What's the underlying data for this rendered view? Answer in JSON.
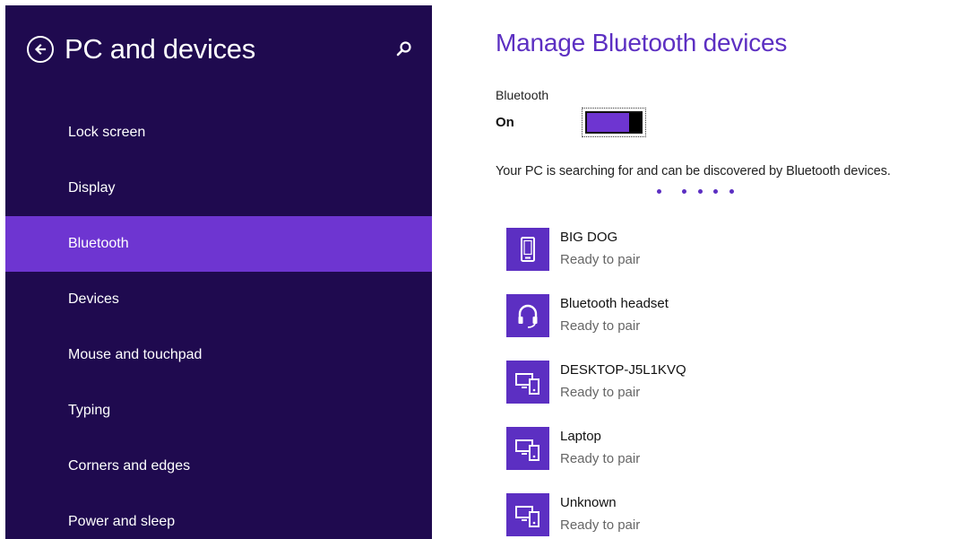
{
  "sidebar": {
    "title": "PC and devices",
    "items": [
      {
        "label": "Lock screen",
        "icon": ""
      },
      {
        "label": "Display"
      },
      {
        "label": "Bluetooth",
        "active": true
      },
      {
        "label": "Devices"
      },
      {
        "label": "Mouse and touchpad"
      },
      {
        "label": "Typing"
      },
      {
        "label": "Corners and edges"
      },
      {
        "label": "Power and sleep"
      }
    ],
    "back_icon": "back-arrow-icon",
    "search_icon": "search-icon"
  },
  "main": {
    "title": "Manage Bluetooth devices",
    "bluetooth_label": "Bluetooth",
    "bluetooth_state": "On",
    "status_message": "Your PC is searching for and can be discovered by Bluetooth devices.",
    "devices": [
      {
        "name": "BIG DOG",
        "status": "Ready to pair",
        "icon": "phone-icon"
      },
      {
        "name": "Bluetooth headset",
        "status": "Ready to pair",
        "icon": "headset-icon"
      },
      {
        "name": "DESKTOP-J5L1KVQ",
        "status": "Ready to pair",
        "icon": "computer-icon"
      },
      {
        "name": "Laptop",
        "status": "Ready to pair",
        "icon": "computer-icon"
      },
      {
        "name": "Unknown",
        "status": "Ready to pair",
        "icon": "computer-icon"
      }
    ]
  },
  "colors": {
    "sidebar_bg": "#1f0a4f",
    "accent": "#6e35d1",
    "title_purple": "#5c2fc2"
  }
}
